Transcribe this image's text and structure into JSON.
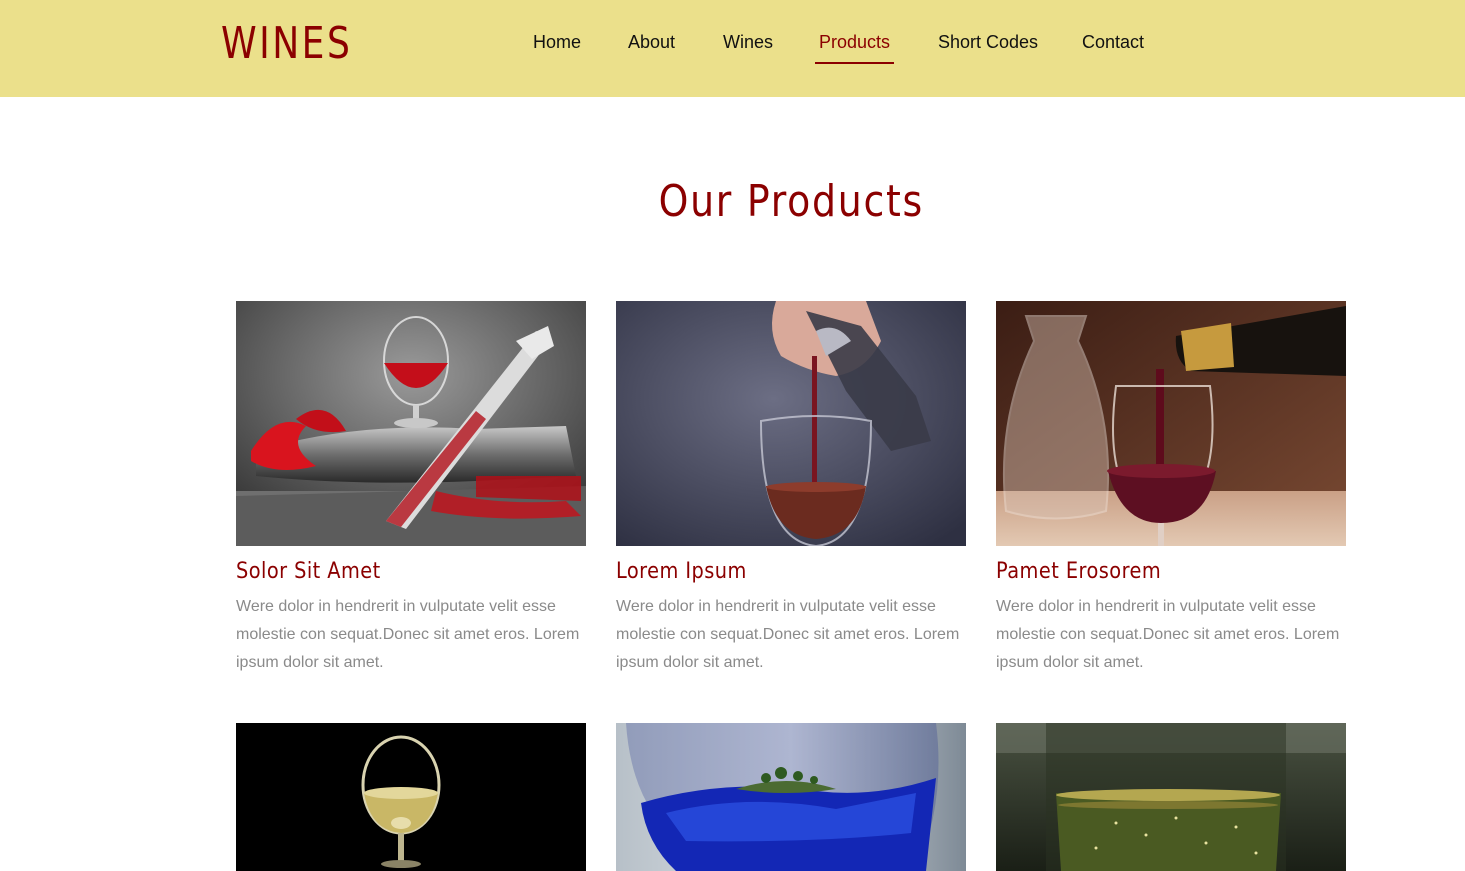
{
  "header": {
    "logo": "WINES",
    "nav": [
      {
        "label": "Home",
        "active": false
      },
      {
        "label": "About",
        "active": false
      },
      {
        "label": "Wines",
        "active": false
      },
      {
        "label": "Products",
        "active": true
      },
      {
        "label": "Short Codes",
        "active": false
      },
      {
        "label": "Contact",
        "active": false
      }
    ]
  },
  "main": {
    "title": "Our Products",
    "products": [
      {
        "name": "Solor Sit Amet",
        "description": "Were dolor in hendrerit in vulputate velit esse molestie con sequat.Donec sit amet eros. Lorem ipsum dolor sit amet.",
        "image": "red-wine-glass-knife-bottle"
      },
      {
        "name": "Lorem Ipsum",
        "description": "Were dolor in hendrerit in vulputate velit esse molestie con sequat.Donec sit amet eros. Lorem ipsum dolor sit amet.",
        "image": "wine-pouring-into-glass"
      },
      {
        "name": "Pamet Erosorem",
        "description": "Were dolor in hendrerit in vulputate velit esse molestie con sequat.Donec sit amet eros. Lorem ipsum dolor sit amet.",
        "image": "bottle-pouring-red-wine-with-carafe"
      },
      {
        "image": "white-wine-glass-on-black"
      },
      {
        "image": "blue-water-glass-with-island"
      },
      {
        "image": "sparkling-wine-glass"
      }
    ]
  },
  "colors": {
    "header_bg": "#ebe08b",
    "accent": "#8b0000",
    "body_text": "#8a8a8a"
  }
}
